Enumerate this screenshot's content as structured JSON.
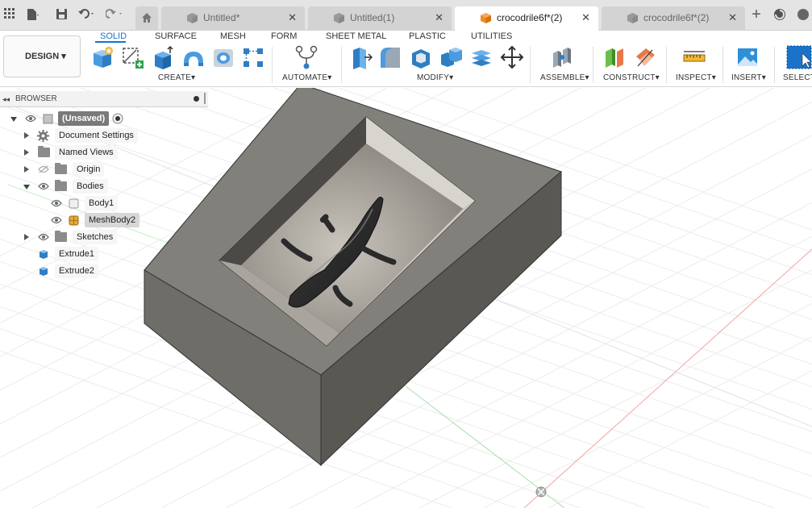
{
  "window": {
    "tabs": [
      {
        "label": "Untitled*",
        "active": false
      },
      {
        "label": "Untitled(1)",
        "active": false
      },
      {
        "label": "crocodrile6f*(2)",
        "active": true
      },
      {
        "label": "crocodrile6f*(2)",
        "active": false
      }
    ],
    "close_glyph": "✕",
    "new_tab_glyph": "+"
  },
  "toolbar": {
    "workspace_button": "DESIGN",
    "workspace_tabs": [
      "SOLID",
      "SURFACE",
      "MESH",
      "FORM",
      "SHEET METAL",
      "PLASTIC",
      "UTILITIES"
    ],
    "active_tab": "SOLID",
    "groups": {
      "create": "CREATE",
      "automate": "AUTOMATE",
      "modify": "MODIFY",
      "assemble": "ASSEMBLE",
      "construct": "CONSTRUCT",
      "inspect": "INSPECT",
      "insert": "INSERT",
      "select": "SELECT"
    },
    "dropdown_glyph": "▾",
    "accent_color": "#1a73c9"
  },
  "browser": {
    "title": "BROWSER",
    "items": [
      {
        "label": "(Unsaved)",
        "icon": "document-icon"
      },
      {
        "label": "Document Settings",
        "icon": "gear-icon"
      },
      {
        "label": "Named Views",
        "icon": "folder-icon"
      },
      {
        "label": "Origin",
        "icon": "folder-icon"
      },
      {
        "label": "Bodies",
        "icon": "folder-icon"
      },
      {
        "label": "Body1",
        "icon": "body-icon"
      },
      {
        "label": "MeshBody2",
        "icon": "mesh-body-icon"
      },
      {
        "label": "Sketches",
        "icon": "folder-icon"
      },
      {
        "label": "Extrude1",
        "icon": "extrude-icon"
      },
      {
        "label": "Extrude2",
        "icon": "extrude-icon"
      }
    ]
  },
  "viewport": {
    "model_name": "crocodile mold",
    "mold_color": "#7b7872",
    "background": "#ffffff"
  }
}
